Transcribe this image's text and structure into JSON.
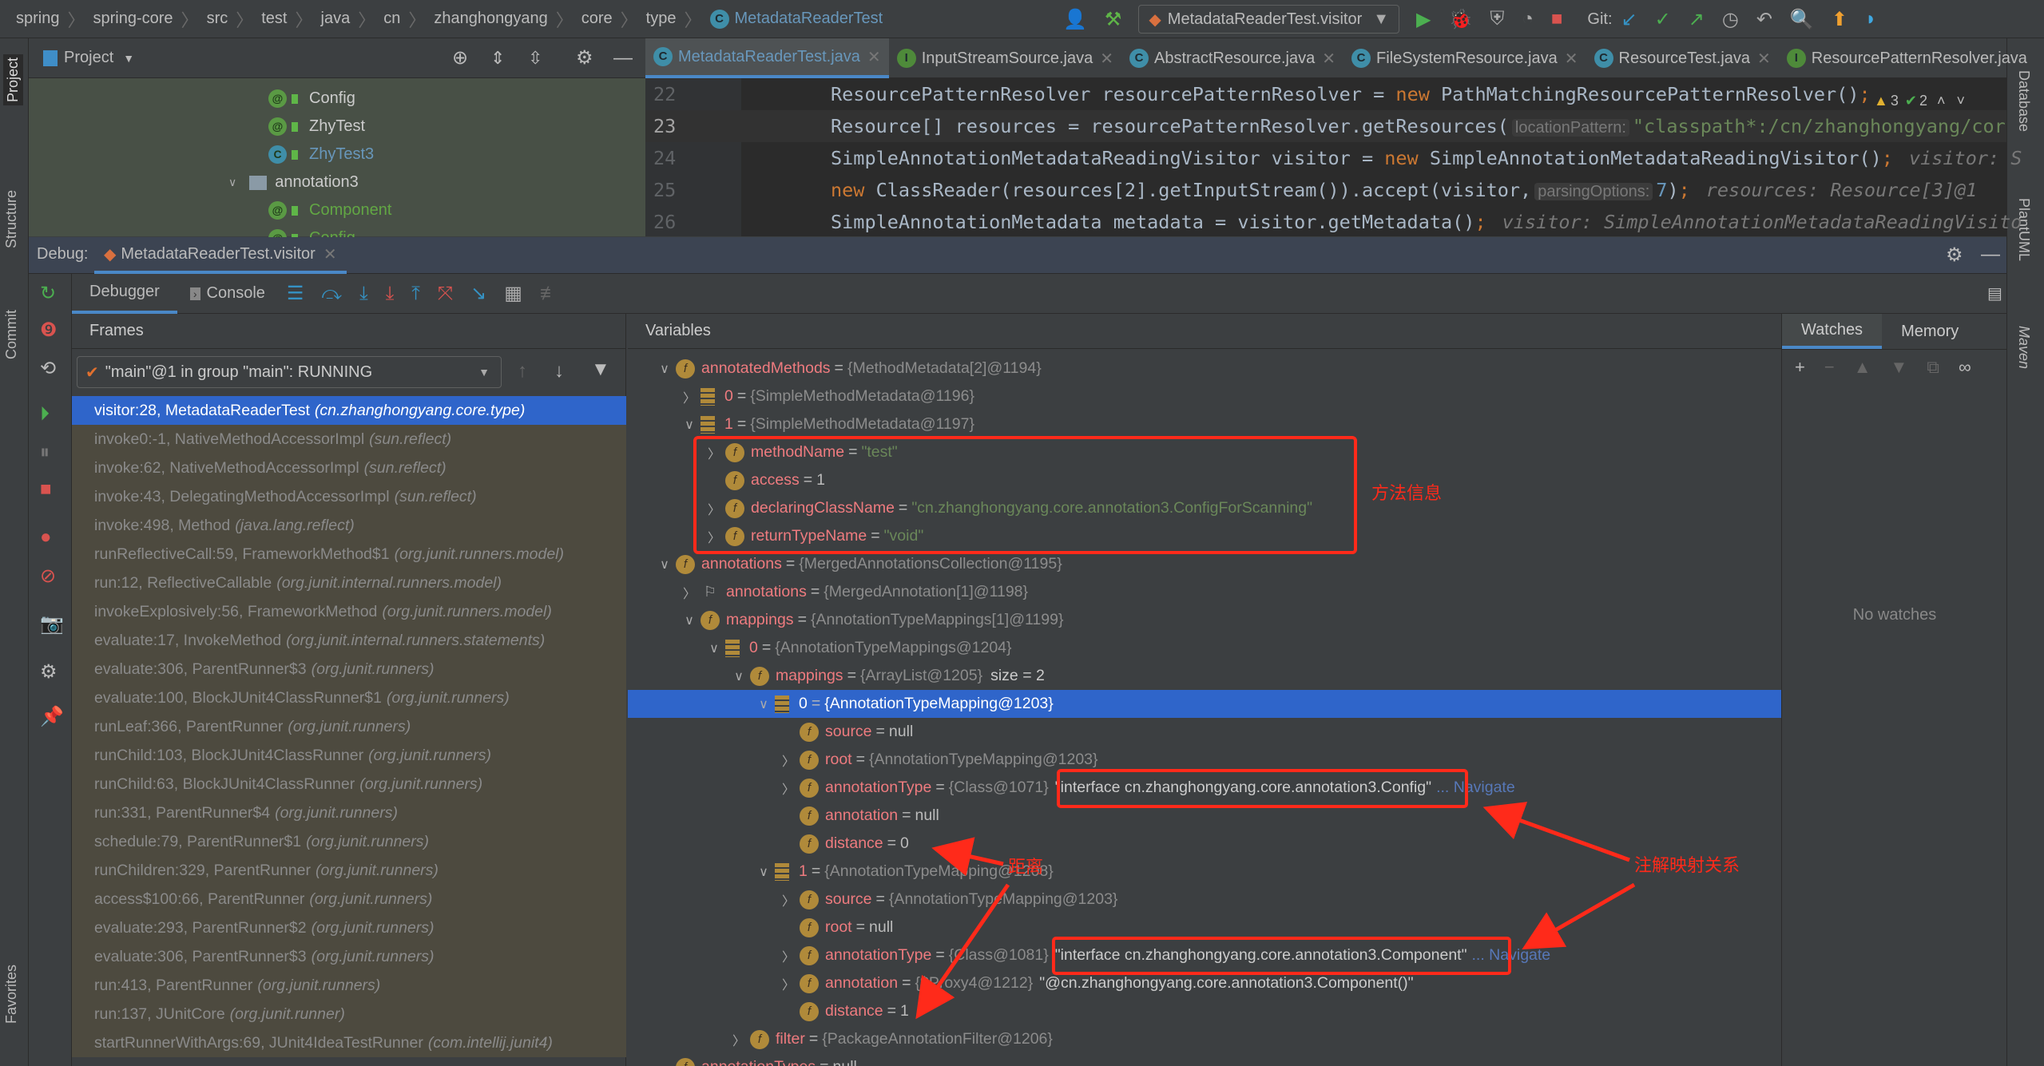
{
  "navbar": {
    "breadcrumbs": [
      "spring",
      "spring-core",
      "src",
      "test",
      "java",
      "cn",
      "zhanghongyang",
      "core",
      "type"
    ],
    "current_class": "MetadataReaderTest",
    "run_config": "MetadataReaderTest.visitor",
    "git_label": "Git:"
  },
  "left_strip": [
    "Project",
    "Structure",
    "Commit",
    "Favorites"
  ],
  "right_strip": [
    "Database",
    "PlantUML",
    "Maven"
  ],
  "project": {
    "title": "Project",
    "tree": [
      {
        "label": "Config",
        "icon": "annotation",
        "color": "#cccccc",
        "level": 1
      },
      {
        "label": "ZhyTest",
        "icon": "annotation",
        "color": "#cccccc",
        "level": 1
      },
      {
        "label": "ZhyTest3",
        "icon": "class",
        "color": "#6897bb",
        "level": 1
      },
      {
        "label": "annotation3",
        "icon": "folder",
        "color": "#cccccc",
        "level": 0
      },
      {
        "label": "Component",
        "icon": "annotation",
        "color": "#62a744",
        "level": 1
      },
      {
        "label": "Config",
        "icon": "annotation",
        "color": "#62a744",
        "level": 1
      }
    ]
  },
  "editor": {
    "tabs": [
      {
        "label": "MetadataReaderTest.java",
        "icon": "C",
        "active": true
      },
      {
        "label": "InputStreamSource.java",
        "icon": "I"
      },
      {
        "label": "AbstractResource.java",
        "icon": "C"
      },
      {
        "label": "FileSystemResource.java",
        "icon": "C"
      },
      {
        "label": "ResourceTest.java",
        "icon": "C"
      },
      {
        "label": "ResourcePatternResolver.java",
        "icon": "I"
      }
    ],
    "warnings": "3",
    "checks": "2",
    "lines": [
      {
        "n": "22",
        "seg": [
          [
            "ResourcePatternResolver resourcePatternResolver = ",
            "plain"
          ],
          [
            "new",
            "kw"
          ],
          [
            " PathMatchingResourcePatternResolver()",
            "plain"
          ],
          [
            ";",
            "kw"
          ]
        ]
      },
      {
        "n": "23",
        "cur": true,
        "seg": [
          [
            "Resource[] resources = resourcePatternResolver.getResources(",
            "plain"
          ],
          [
            "locationPattern:",
            "inlay"
          ],
          [
            "\"classpath*:/cn/zhanghongyang/cor",
            "str"
          ]
        ]
      },
      {
        "n": "24",
        "seg": [
          [
            "SimpleAnnotationMetadataReadingVisitor visitor = ",
            "plain"
          ],
          [
            "new",
            "kw"
          ],
          [
            " SimpleAnnotationMetadataReadingVisitor()",
            "plain"
          ],
          [
            ";",
            "kw"
          ],
          [
            "visitor: S",
            "hint"
          ]
        ]
      },
      {
        "n": "25",
        "seg": [
          [
            "new",
            "kw"
          ],
          [
            " ClassReader(resources[2].getInputStream()).accept(visitor,",
            "plain"
          ],
          [
            "parsingOptions:",
            "inlay"
          ],
          [
            "7",
            "num"
          ],
          [
            ")",
            "plain"
          ],
          [
            ";",
            "kw"
          ],
          [
            "resources: Resource[3]@1",
            "hint"
          ]
        ]
      },
      {
        "n": "26",
        "seg": [
          [
            "SimpleAnnotationMetadata metadata = visitor.getMetadata()",
            "plain"
          ],
          [
            ";",
            "kw"
          ],
          [
            "visitor: SimpleAnnotationMetadataReadingVisito",
            "hint"
          ]
        ]
      }
    ]
  },
  "debug": {
    "label": "Debug:",
    "session": "MetadataReaderTest.visitor",
    "tabs": {
      "debugger": "Debugger",
      "console": "Console"
    },
    "frames_title": "Frames",
    "thread": "\"main\"@1 in group \"main\": RUNNING",
    "frames": [
      [
        "visitor:28, MetadataReaderTest",
        "(cn.zhanghongyang.core.type)"
      ],
      [
        "invoke0:-1, NativeMethodAccessorImpl",
        "(sun.reflect)"
      ],
      [
        "invoke:62, NativeMethodAccessorImpl",
        "(sun.reflect)"
      ],
      [
        "invoke:43, DelegatingMethodAccessorImpl",
        "(sun.reflect)"
      ],
      [
        "invoke:498, Method",
        "(java.lang.reflect)"
      ],
      [
        "runReflectiveCall:59, FrameworkMethod$1",
        "(org.junit.runners.model)"
      ],
      [
        "run:12, ReflectiveCallable",
        "(org.junit.internal.runners.model)"
      ],
      [
        "invokeExplosively:56, FrameworkMethod",
        "(org.junit.runners.model)"
      ],
      [
        "evaluate:17, InvokeMethod",
        "(org.junit.internal.runners.statements)"
      ],
      [
        "evaluate:306, ParentRunner$3",
        "(org.junit.runners)"
      ],
      [
        "evaluate:100, BlockJUnit4ClassRunner$1",
        "(org.junit.runners)"
      ],
      [
        "runLeaf:366, ParentRunner",
        "(org.junit.runners)"
      ],
      [
        "runChild:103, BlockJUnit4ClassRunner",
        "(org.junit.runners)"
      ],
      [
        "runChild:63, BlockJUnit4ClassRunner",
        "(org.junit.runners)"
      ],
      [
        "run:331, ParentRunner$4",
        "(org.junit.runners)"
      ],
      [
        "schedule:79, ParentRunner$1",
        "(org.junit.runners)"
      ],
      [
        "runChildren:329, ParentRunner",
        "(org.junit.runners)"
      ],
      [
        "access$100:66, ParentRunner",
        "(org.junit.runners)"
      ],
      [
        "evaluate:293, ParentRunner$2",
        "(org.junit.runners)"
      ],
      [
        "evaluate:306, ParentRunner$3",
        "(org.junit.runners)"
      ],
      [
        "run:413, ParentRunner",
        "(org.junit.runners)"
      ],
      [
        "run:137, JUnitCore",
        "(org.junit.runner)"
      ],
      [
        "startRunnerWithArgs:69, JUnit4IdeaTestRunner",
        "(com.intellij.junit4)"
      ]
    ],
    "variables_title": "Variables",
    "variables": [
      {
        "lv": 0,
        "ex": "open",
        "ic": "field",
        "name": "annotatedMethods",
        "val": "{MethodMetadata[2]@1194}",
        "kind": "ref"
      },
      {
        "lv": 1,
        "ex": "closed",
        "ic": "array",
        "name": "0",
        "val": "{SimpleMethodMetadata@1196}",
        "kind": "ref"
      },
      {
        "lv": 1,
        "ex": "open",
        "ic": "array",
        "name": "1",
        "val": "{SimpleMethodMetadata@1197}",
        "kind": "ref"
      },
      {
        "lv": 2,
        "ex": "closed",
        "ic": "field",
        "name": "methodName",
        "val": "\"test\"",
        "kind": "string"
      },
      {
        "lv": 2,
        "ex": "none",
        "ic": "field",
        "name": "access",
        "val": "1",
        "kind": "plain"
      },
      {
        "lv": 2,
        "ex": "closed",
        "ic": "field",
        "name": "declaringClassName",
        "val": "\"cn.zhanghongyang.core.annotation3.ConfigForScanning\"",
        "kind": "string"
      },
      {
        "lv": 2,
        "ex": "closed",
        "ic": "field",
        "name": "returnTypeName",
        "val": "\"void\"",
        "kind": "string"
      },
      {
        "lv": 0,
        "ex": "open",
        "ic": "field",
        "name": "annotations",
        "val": "{MergedAnnotationsCollection@1195}",
        "kind": "ref"
      },
      {
        "lv": 1,
        "ex": "closed",
        "ic": "flag",
        "name": "annotations",
        "val": "{MergedAnnotation[1]@1198}",
        "kind": "ref"
      },
      {
        "lv": 1,
        "ex": "open",
        "ic": "field",
        "name": "mappings",
        "val": "{AnnotationTypeMappings[1]@1199}",
        "kind": "ref"
      },
      {
        "lv": 2,
        "ex": "open",
        "ic": "array",
        "name": "0",
        "val": "{AnnotationTypeMappings@1204}",
        "kind": "ref"
      },
      {
        "lv": 3,
        "ex": "open",
        "ic": "field",
        "name": "mappings",
        "val": "{ArrayList@1205}",
        "kind": "ref",
        "extra": "size = 2"
      },
      {
        "lv": 4,
        "ex": "open",
        "ic": "array",
        "name": "0",
        "val": "{AnnotationTypeMapping@1203}",
        "kind": "ref",
        "sel": true
      },
      {
        "lv": 5,
        "ex": "none",
        "ic": "field",
        "name": "source",
        "val": "null",
        "kind": "plain"
      },
      {
        "lv": 5,
        "ex": "closed",
        "ic": "field",
        "name": "root",
        "val": "{AnnotationTypeMapping@1203}",
        "kind": "ref"
      },
      {
        "lv": 5,
        "ex": "closed",
        "ic": "field",
        "name": "annotationType",
        "val": "{Class@1071}",
        "kind": "ref",
        "suffix": "\"interface cn.zhanghongyang.core.annotation3.Config\"",
        "nav": "... Navigate"
      },
      {
        "lv": 5,
        "ex": "none",
        "ic": "field",
        "name": "annotation",
        "val": "null",
        "kind": "plain"
      },
      {
        "lv": 5,
        "ex": "none",
        "ic": "field",
        "name": "distance",
        "val": "0",
        "kind": "plain"
      },
      {
        "lv": 4,
        "ex": "open",
        "ic": "array",
        "name": "1",
        "val": "{AnnotationTypeMapping@1208}",
        "kind": "ref"
      },
      {
        "lv": 5,
        "ex": "closed",
        "ic": "field",
        "name": "source",
        "val": "{AnnotationTypeMapping@1203}",
        "kind": "ref"
      },
      {
        "lv": 5,
        "ex": "none",
        "ic": "field",
        "name": "root",
        "val": "null",
        "kind": "plain"
      },
      {
        "lv": 5,
        "ex": "closed",
        "ic": "field",
        "name": "annotationType",
        "val": "{Class@1081}",
        "kind": "ref",
        "suffix": "\"interface cn.zhanghongyang.core.annotation3.Component\"",
        "nav": "... Navigate"
      },
      {
        "lv": 5,
        "ex": "closed",
        "ic": "field",
        "name": "annotation",
        "val": "{$Proxy4@1212}",
        "kind": "ref",
        "suffix": "\"@cn.zhanghongyang.core.annotation3.Component()\""
      },
      {
        "lv": 5,
        "ex": "none",
        "ic": "field",
        "name": "distance",
        "val": "1",
        "kind": "plain"
      },
      {
        "lv": 3,
        "ex": "closed",
        "ic": "field",
        "name": "filter",
        "val": "{PackageAnnotationFilter@1206}",
        "kind": "ref"
      },
      {
        "lv": 0,
        "ex": "none",
        "ic": "field",
        "name": "annotationTypes",
        "val": "null",
        "kind": "plain"
      }
    ],
    "watches": {
      "tabs": [
        "Watches",
        "Memory"
      ],
      "empty": "No watches"
    }
  },
  "annotations": {
    "method_info": "方法信息",
    "distance": "距离",
    "mapping_relation": "注解映射关系",
    "color": "#ff2a1a"
  }
}
